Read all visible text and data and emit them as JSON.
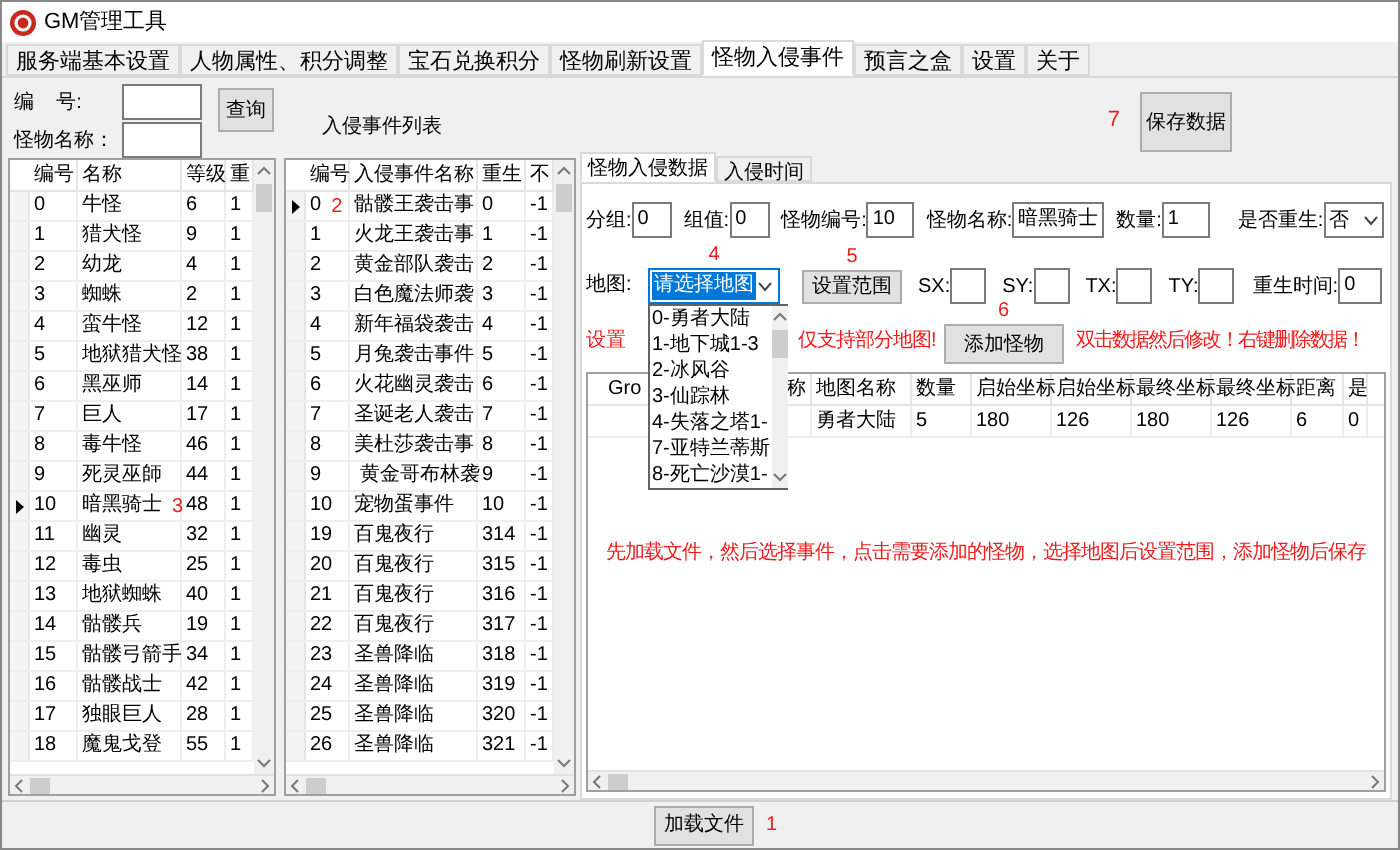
{
  "window": {
    "title": "GM管理工具"
  },
  "tabs": [
    {
      "label": "服务端基本设置",
      "selected": false
    },
    {
      "label": "人物属性、积分调整",
      "selected": false
    },
    {
      "label": "宝石兑换积分",
      "selected": false
    },
    {
      "label": "怪物刷新设置",
      "selected": false
    },
    {
      "label": "怪物入侵事件",
      "selected": true
    },
    {
      "label": "预言之盒",
      "selected": false
    },
    {
      "label": "设置",
      "selected": false
    },
    {
      "label": "关于",
      "selected": false
    }
  ],
  "search": {
    "id_label": "编    号:",
    "name_label": "怪物名称：",
    "button": "查询"
  },
  "event_list_title": "入侵事件列表",
  "monster_table": {
    "columns": [
      "编号",
      "名称",
      "等级",
      "重"
    ],
    "rows": [
      {
        "cells": [
          "0",
          "牛怪",
          "6",
          "1"
        ],
        "selected": false
      },
      {
        "cells": [
          "1",
          "猎犬怪",
          "9",
          "1"
        ],
        "selected": false
      },
      {
        "cells": [
          "2",
          "幼龙",
          "4",
          "1"
        ],
        "selected": false
      },
      {
        "cells": [
          "3",
          "蜘蛛",
          "2",
          "1"
        ],
        "selected": false
      },
      {
        "cells": [
          "4",
          "蛮牛怪",
          "12",
          "1"
        ],
        "selected": false
      },
      {
        "cells": [
          "5",
          "地狱猎犬怪",
          "38",
          "1"
        ],
        "selected": false
      },
      {
        "cells": [
          "6",
          "黑巫师",
          "14",
          "1"
        ],
        "selected": false
      },
      {
        "cells": [
          "7",
          "巨人",
          "17",
          "1"
        ],
        "selected": false
      },
      {
        "cells": [
          "8",
          "毒牛怪",
          "46",
          "1"
        ],
        "selected": false
      },
      {
        "cells": [
          "9",
          "死灵巫師",
          "44",
          "1"
        ],
        "selected": false
      },
      {
        "cells": [
          "10",
          "暗黑骑士",
          "48",
          "1"
        ],
        "selected": true,
        "note": "3"
      },
      {
        "cells": [
          "11",
          "幽灵",
          "32",
          "1"
        ],
        "selected": false
      },
      {
        "cells": [
          "12",
          "毒虫",
          "25",
          "1"
        ],
        "selected": false
      },
      {
        "cells": [
          "13",
          "地狱蜘蛛",
          "40",
          "1"
        ],
        "selected": false
      },
      {
        "cells": [
          "14",
          "骷髅兵",
          "19",
          "1"
        ],
        "selected": false
      },
      {
        "cells": [
          "15",
          "骷髅弓箭手",
          "34",
          "1"
        ],
        "selected": false
      },
      {
        "cells": [
          "16",
          "骷髅战士",
          "42",
          "1"
        ],
        "selected": false
      },
      {
        "cells": [
          "17",
          "独眼巨人",
          "28",
          "1"
        ],
        "selected": false
      },
      {
        "cells": [
          "18",
          "魔鬼戈登",
          "55",
          "1"
        ],
        "selected": false
      }
    ]
  },
  "event_table": {
    "columns": [
      "编号",
      "入侵事件名称",
      "重生",
      "不"
    ],
    "rows": [
      {
        "cells": [
          "0",
          "骷髅王袭击事",
          "0",
          "-1"
        ],
        "selected": true,
        "note": "2"
      },
      {
        "cells": [
          "1",
          "火龙王袭击事",
          "1",
          "-1"
        ],
        "selected": false
      },
      {
        "cells": [
          "2",
          "黄金部队袭击",
          "2",
          "-1"
        ],
        "selected": false
      },
      {
        "cells": [
          "3",
          "白色魔法师袭",
          "3",
          "-1"
        ],
        "selected": false
      },
      {
        "cells": [
          "4",
          "新年福袋袭击",
          "4",
          "-1"
        ],
        "selected": false
      },
      {
        "cells": [
          "5",
          "月兔袭击事件",
          "5",
          "-1"
        ],
        "selected": false
      },
      {
        "cells": [
          "6",
          "火花幽灵袭击",
          "6",
          "-1"
        ],
        "selected": false
      },
      {
        "cells": [
          "7",
          "圣诞老人袭击",
          "7",
          "-1"
        ],
        "selected": false
      },
      {
        "cells": [
          "8",
          "美杜莎袭击事",
          "8",
          "-1"
        ],
        "selected": false
      },
      {
        "cells": [
          "9",
          " 黄金哥布林袭",
          "9",
          "-1"
        ],
        "selected": false
      },
      {
        "cells": [
          "10",
          "宠物蛋事件",
          "10",
          "-1"
        ],
        "selected": false
      },
      {
        "cells": [
          "19",
          "百鬼夜行",
          "314",
          "-1"
        ],
        "selected": false
      },
      {
        "cells": [
          "20",
          "百鬼夜行",
          "315",
          "-1"
        ],
        "selected": false
      },
      {
        "cells": [
          "21",
          "百鬼夜行",
          "316",
          "-1"
        ],
        "selected": false
      },
      {
        "cells": [
          "22",
          "百鬼夜行",
          "317",
          "-1"
        ],
        "selected": false
      },
      {
        "cells": [
          "23",
          "圣兽降临",
          "318",
          "-1"
        ],
        "selected": false
      },
      {
        "cells": [
          "24",
          "圣兽降临",
          "319",
          "-1"
        ],
        "selected": false
      },
      {
        "cells": [
          "25",
          "圣兽降临",
          "320",
          "-1"
        ],
        "selected": false
      },
      {
        "cells": [
          "26",
          "圣兽降临",
          "321",
          "-1"
        ],
        "selected": false
      }
    ]
  },
  "save": {
    "note": "7",
    "label": "保存数据"
  },
  "inner_tabs": [
    {
      "label": "怪物入侵数据",
      "selected": true
    },
    {
      "label": "入侵时间",
      "selected": false
    }
  ],
  "fields": [
    {
      "label": "分组:",
      "value": "0"
    },
    {
      "label": "组值:",
      "value": "0"
    },
    {
      "label": "怪物编号:",
      "value": "10"
    },
    {
      "label": "怪物名称:",
      "value": "暗黑骑士"
    },
    {
      "label": "数量:",
      "value": "1"
    }
  ],
  "respawn": {
    "label": "是否重生:",
    "value": "否"
  },
  "map": {
    "label": "地图:",
    "value": "请选择地图",
    "note": "4",
    "options": [
      "0-勇者大陆",
      "1-地下城1-3",
      "2-冰风谷",
      "3-仙踪林",
      "4-失落之塔1-",
      "7-亚特兰蒂斯",
      "8-死亡沙漠1-"
    ]
  },
  "range_button": {
    "label": "设置范围",
    "note": "5"
  },
  "coords": [
    {
      "label": "SX:"
    },
    {
      "label": "SY:"
    },
    {
      "label": "TX:"
    },
    {
      "label": "TY:"
    }
  ],
  "respawn_time": {
    "label": "重生时间:",
    "value": "0"
  },
  "hints": [
    "设置",
    "仅支持部分地图!"
  ],
  "add_button": {
    "label": "添加怪物",
    "note": "6"
  },
  "edit_hint": "双击数据然后修改！右键删除数据！",
  "data_grid": {
    "columns": [
      "Gro",
      "称",
      "地图名称",
      "数量",
      "启始坐标",
      "启始坐标",
      "最终坐标",
      "最终坐标",
      "距离",
      "是"
    ],
    "rows": [
      {
        "cells": [
          "",
          "",
          "勇者大陆",
          "5",
          "180",
          "126",
          "180",
          "126",
          "6",
          "0"
        ]
      }
    ]
  },
  "instructions": "先加载文件，然后选择事件，点击需要添加的怪物，选择地图后设置范围，添加怪物后保存",
  "load": {
    "label": "加载文件",
    "note": "1"
  }
}
